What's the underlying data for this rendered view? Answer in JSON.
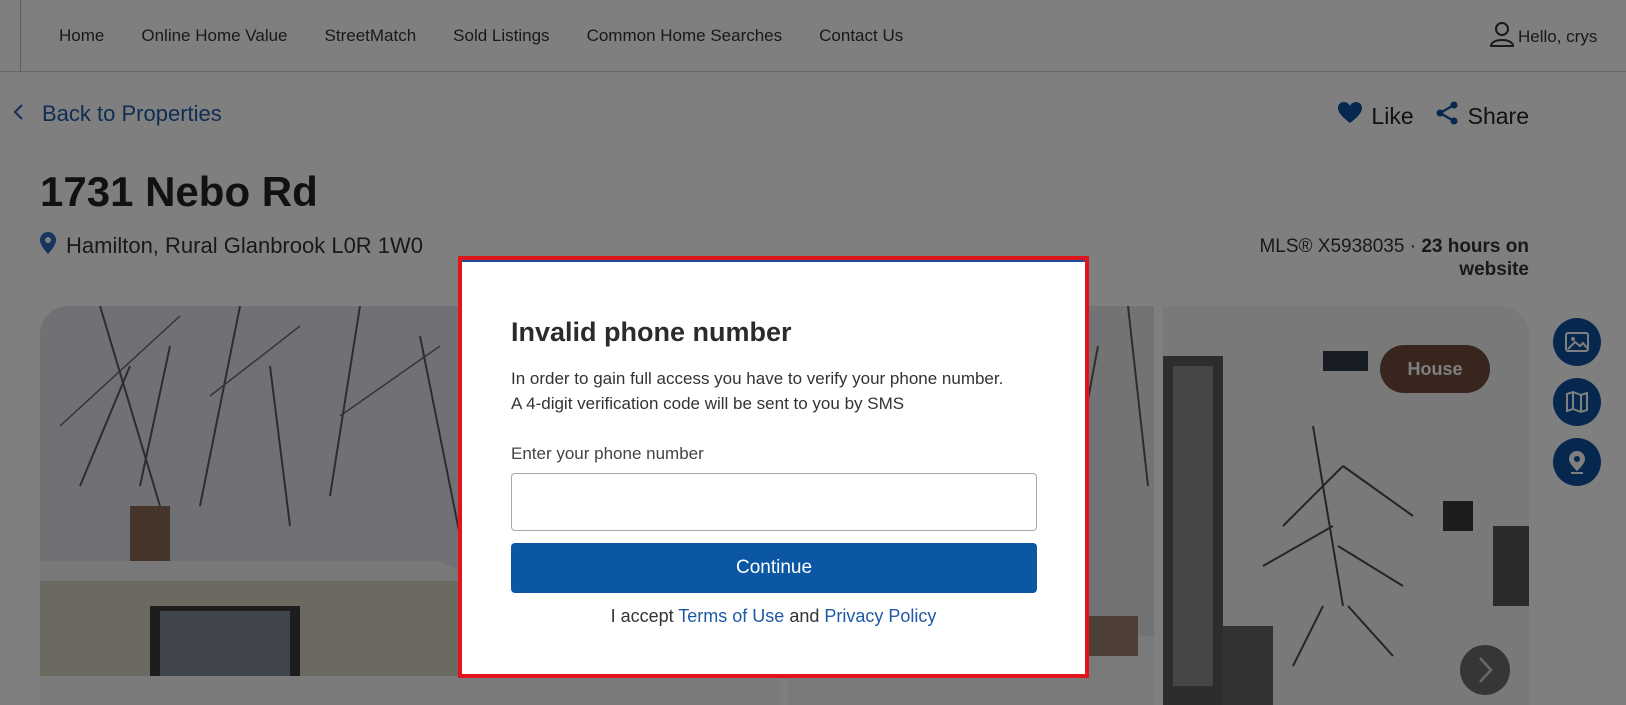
{
  "nav": {
    "items": [
      "Home",
      "Online Home Value",
      "StreetMatch",
      "Sold Listings",
      "Common Home Searches",
      "Contact Us"
    ],
    "user_greeting": "Hello, crys"
  },
  "listing": {
    "back_label": "Back to Properties",
    "like_label": "Like",
    "share_label": "Share",
    "title": "1731 Nebo Rd",
    "address": "Hamilton, Rural Glanbrook L0R 1W0",
    "mls_prefix": "MLS® X5938035 · ",
    "time_on_site": "23 hours on website",
    "property_type_badge": "House"
  },
  "modal": {
    "title": "Invalid phone number",
    "desc_line1": "In order to gain full access you have to verify your phone number.",
    "desc_line2": "A 4-digit verification code will be sent to you by SMS",
    "phone_label": "Enter your phone number",
    "phone_value": "",
    "continue_label": "Continue",
    "terms_prefix": "I accept ",
    "terms_link": "Terms of Use",
    "terms_and": " and ",
    "privacy_link": "Privacy Policy"
  },
  "colors": {
    "accent": "#0c57a4",
    "link": "#1f5aa6",
    "modal_border": "#e0141c",
    "badge": "#6e4a3d"
  }
}
